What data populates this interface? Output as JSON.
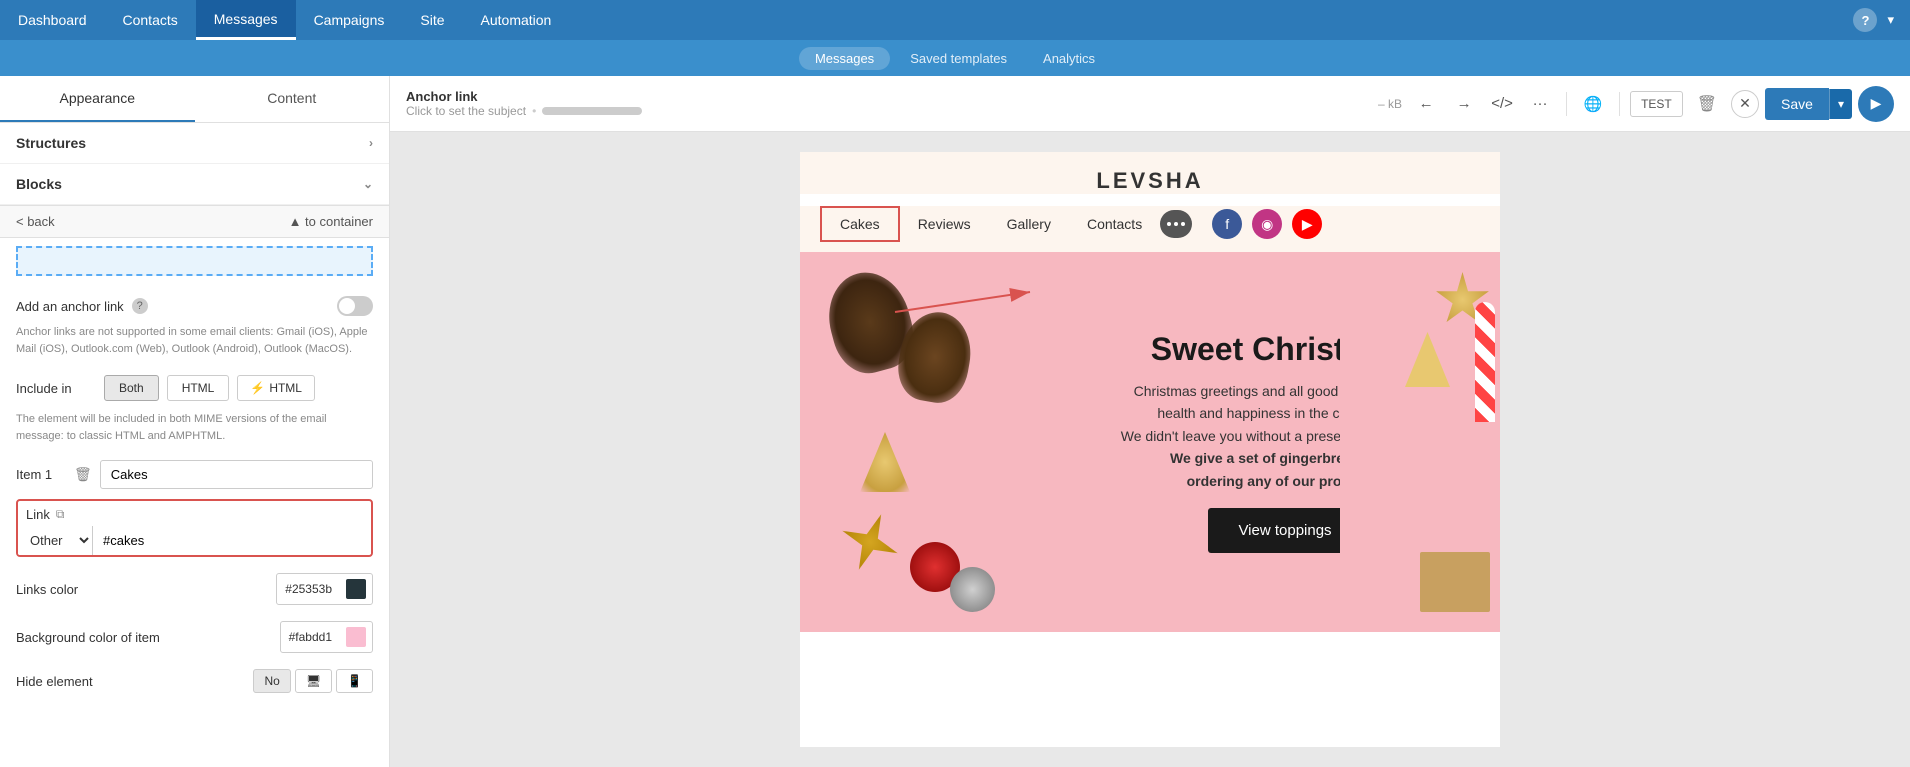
{
  "topNav": {
    "items": [
      {
        "label": "Dashboard",
        "active": false
      },
      {
        "label": "Contacts",
        "active": false
      },
      {
        "label": "Messages",
        "active": true
      },
      {
        "label": "Campaigns",
        "active": false
      },
      {
        "label": "Site",
        "active": false
      },
      {
        "label": "Automation",
        "active": false
      }
    ],
    "helpIcon": "?",
    "userDropdown": "▾"
  },
  "subNav": {
    "items": [
      {
        "label": "Messages",
        "active": true
      },
      {
        "label": "Saved templates",
        "active": false
      },
      {
        "label": "Analytics",
        "active": false
      }
    ]
  },
  "leftPanel": {
    "tabs": [
      {
        "label": "Appearance",
        "active": true
      },
      {
        "label": "Content",
        "active": false
      }
    ],
    "structures": {
      "label": "Structures"
    },
    "blocks": {
      "label": "Blocks"
    },
    "backBtn": "< back",
    "toContainerBtn": "▲ to container",
    "anchorLink": {
      "label": "Add an anchor link",
      "helpText": "?",
      "warningText": "Anchor links are not supported in some email clients: Gmail (iOS), Apple Mail (iOS), Outlook.com (Web), Outlook (Android), Outlook (MacOS)."
    },
    "includeIn": {
      "label": "Include in",
      "options": [
        "Both",
        "HTML",
        "⚡ HTML"
      ],
      "description": "The element will be included in both MIME versions of the email message: to classic HTML and AMPHTML."
    },
    "item1": {
      "label": "Item 1",
      "value": "Cakes"
    },
    "link": {
      "label": "Link",
      "copyIcon": "⧉",
      "type": "Other",
      "value": "#cakes"
    },
    "linksColor": {
      "label": "Links color",
      "value": "#25353b"
    },
    "bgColor": {
      "label": "Background color of item",
      "value": "#fabdd1"
    },
    "hideElement": {
      "label": "Hide element",
      "options": [
        "No",
        "🖥",
        "📱"
      ]
    }
  },
  "toolbar": {
    "emailTitle": "Anchor link",
    "emailSubtitle": "Click to set the subject",
    "kbSize": "– kB",
    "saveLabel": "Save",
    "playIcon": "▶"
  },
  "preview": {
    "brandName": "LEVSHA",
    "navItems": [
      {
        "label": "Cakes",
        "highlighted": true
      },
      {
        "label": "Reviews",
        "highlighted": false
      },
      {
        "label": "Gallery",
        "highlighted": false
      },
      {
        "label": "Contacts",
        "highlighted": false
      }
    ],
    "social": [
      "f",
      "◉",
      "▶"
    ],
    "hero": {
      "title": "Sweet Christmas!",
      "body1": "Christmas greetings and all good wishes for your",
      "body2": "health and happiness in the coming year!",
      "body3": "We didn't leave you without a present this Christmas!",
      "body4Bold": "We give a set of gingerbread when",
      "body5Bold": "ordering any of our products!",
      "cta": "View toppings"
    }
  }
}
